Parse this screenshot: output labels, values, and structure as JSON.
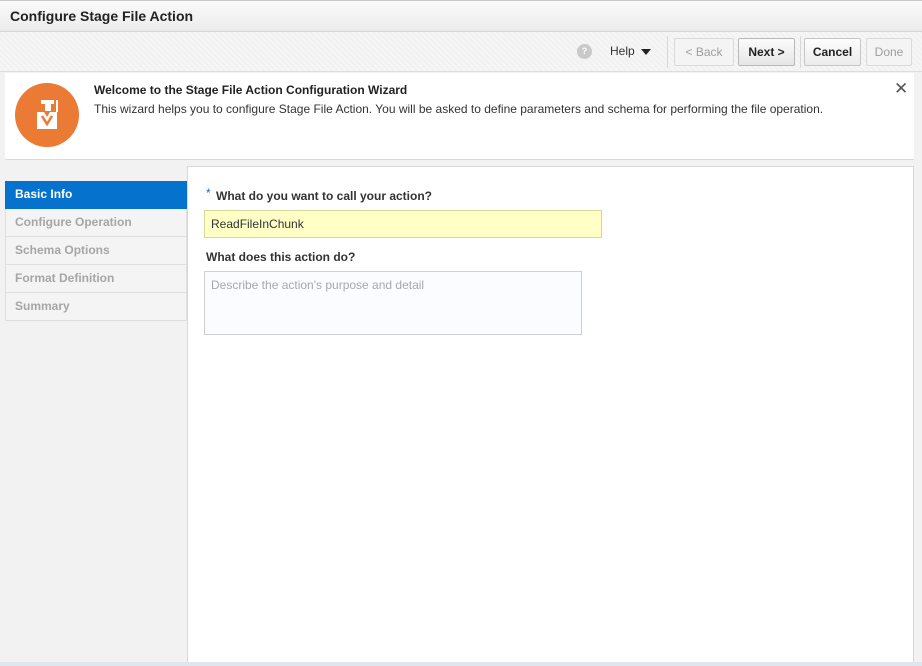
{
  "window": {
    "title": "Configure Stage File Action"
  },
  "toolbar": {
    "help_label": "Help",
    "back_label": "< Back",
    "next_label": "Next >",
    "cancel_label": "Cancel",
    "done_label": "Done"
  },
  "banner": {
    "title": "Welcome to the Stage File Action Configuration Wizard",
    "text": "This wizard helps you to configure Stage File Action. You will be asked to define parameters and schema for performing the file operation.",
    "close_glyph": "✕",
    "logo_icon": "wizard-hat-icon",
    "logo_color": "#ea7a34"
  },
  "nav": {
    "items": [
      {
        "label": "Basic Info",
        "active": true
      },
      {
        "label": "Configure Operation",
        "active": false
      },
      {
        "label": "Schema Options",
        "active": false
      },
      {
        "label": "Format Definition",
        "active": false
      },
      {
        "label": "Summary",
        "active": false
      }
    ],
    "active_color": "#0572ce"
  },
  "form": {
    "required_mark": "*",
    "name_label": "What do you want to call your action?",
    "name_value": "ReadFileInChunk",
    "desc_label": "What does this action do?",
    "desc_placeholder": "Describe the action's purpose and detail",
    "desc_value": ""
  }
}
